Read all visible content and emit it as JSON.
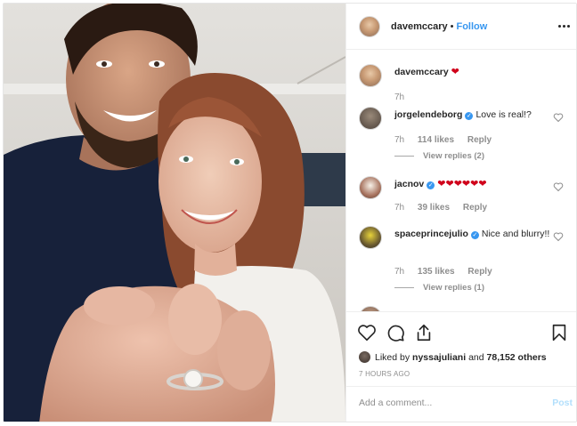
{
  "post": {
    "username": "davemccary",
    "follow_label": "Follow",
    "separator": "•"
  },
  "comments": [
    {
      "username": "davemccary",
      "text": "",
      "hearts": "❤",
      "time": "7h",
      "verified": false
    },
    {
      "username": "jorgelendeborg",
      "text": "Love is real!?",
      "time": "7h",
      "likes": "114 likes",
      "reply": "Reply",
      "view_replies": "View replies (2)",
      "verified": true
    },
    {
      "username": "jacnov",
      "text": "",
      "hearts": "❤❤❤❤❤❤",
      "time": "7h",
      "likes": "39 likes",
      "reply": "Reply",
      "verified": true
    },
    {
      "username": "spaceprincejulio",
      "text": "Nice and blurry!!",
      "time": "7h",
      "likes": "135 likes",
      "reply": "Reply",
      "view_replies": "View replies (1)",
      "verified": true
    }
  ],
  "likes_line": {
    "prefix": "Liked by",
    "user": "nyssajuliani",
    "middle": "and",
    "others": "78,152 others"
  },
  "time_ago": "7 HOURS AGO",
  "comment_box": {
    "placeholder": "Add a comment...",
    "post_label": "Post"
  },
  "colors": {
    "accent": "#3897f0",
    "heart": "#d0021b",
    "muted": "#8e8e8e",
    "post_disabled": "#b2dffc"
  }
}
